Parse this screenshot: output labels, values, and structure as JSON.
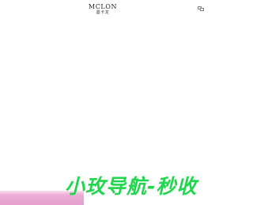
{
  "header": {
    "logo_text": "MCLON",
    "logo_subtext": "曼卡龙",
    "language_icon": "translate-icon"
  },
  "promo": {
    "text": "小玫导航-秒收"
  },
  "colors": {
    "background": "#ffffff",
    "promo_text": "#1fd64d",
    "banner_pink": "#e9a6d4",
    "logo": "#222222"
  }
}
